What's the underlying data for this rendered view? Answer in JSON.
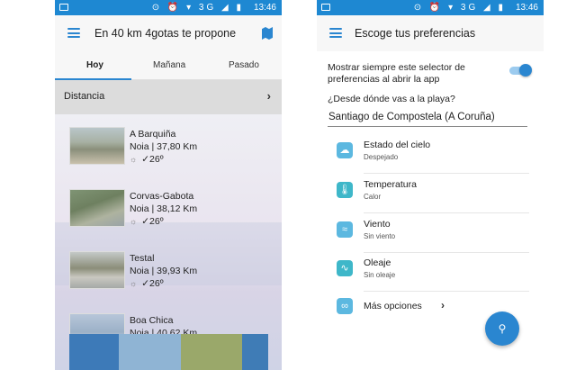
{
  "left_screen": {
    "status_bar": {
      "icons": "⊙ ⏰ ▾ 3G ◢ ▮",
      "time": "13:46"
    },
    "app_bar": {
      "title": "En 40 km 4gotas te propone"
    },
    "tabs": [
      {
        "label": "Hoy",
        "active": true
      },
      {
        "label": "Mañana",
        "active": false
      },
      {
        "label": "Pasado",
        "active": false
      }
    ],
    "filter": {
      "label": "Distancia"
    },
    "beaches": [
      {
        "name": "A Barquiña",
        "location_distance": "Noia | 37,80 Km",
        "temperature": "✓26º"
      },
      {
        "name": "Corvas-Gabota",
        "location_distance": "Noia | 38,12 Km",
        "temperature": "✓26º"
      },
      {
        "name": "Testal",
        "location_distance": "Noia | 39,93 Km",
        "temperature": "✓26º"
      },
      {
        "name": "Boa Chica",
        "location_distance": "Noia | 40,62 Km",
        "temperature": ""
      }
    ],
    "ad_colors": [
      "#3d7ab8",
      "#8fb4d4",
      "#9aa86a",
      "#3f7cb6"
    ]
  },
  "right_screen": {
    "status_bar": {
      "icons": "⊙ ⏰ ▾ 3G ◢ ▮",
      "time": "13:46"
    },
    "app_bar": {
      "title": "Escoge tus preferencias"
    },
    "toggle_label": "Mostrar siempre este selector de preferencias al abrir la app",
    "toggle_on": true,
    "question": "¿Desde dónde vas a la playa?",
    "location_value": "Santiago de Compostela (A Coruña)",
    "preferences": [
      {
        "title": "Estado del cielo",
        "value": "Despejado",
        "icon": "cloud-icon"
      },
      {
        "title": "Temperatura",
        "value": "Calor",
        "icon": "thermometer-icon"
      },
      {
        "title": "Viento",
        "value": "Sin viento",
        "icon": "wind-icon"
      },
      {
        "title": "Oleaje",
        "value": "Sin oleaje",
        "icon": "wave-icon"
      }
    ],
    "more_options": "Más opciones",
    "accent_color": "#2a86d0"
  }
}
